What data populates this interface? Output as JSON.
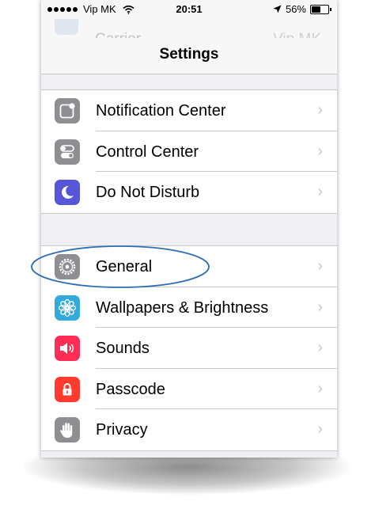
{
  "status_bar": {
    "carrier": "Vip MK",
    "time": "20:51",
    "battery_percent": "56%",
    "battery_level": 0.56
  },
  "scrolled_row": {
    "label": "Carrier",
    "value": "Vip MK"
  },
  "nav": {
    "title": "Settings"
  },
  "groups": [
    {
      "rows": [
        {
          "label": "Notification Center",
          "icon": "notification-center-icon",
          "color": "#8e8e93"
        },
        {
          "label": "Control Center",
          "icon": "control-center-icon",
          "color": "#8e8e93"
        },
        {
          "label": "Do Not Disturb",
          "icon": "moon-icon",
          "color": "#5856d6"
        }
      ]
    },
    {
      "rows": [
        {
          "label": "General",
          "icon": "gear-icon",
          "color": "#8e8e93"
        },
        {
          "label": "Wallpapers & Brightness",
          "icon": "flower-icon",
          "color": "#34aadc"
        },
        {
          "label": "Sounds",
          "icon": "speaker-icon",
          "color": "#ff2d55"
        },
        {
          "label": "Passcode",
          "icon": "lock-icon",
          "color": "#ff3b30"
        },
        {
          "label": "Privacy",
          "icon": "hand-icon",
          "color": "#8e8e93"
        }
      ]
    }
  ],
  "chevron": "›",
  "highlight_color": "#2c6db5"
}
